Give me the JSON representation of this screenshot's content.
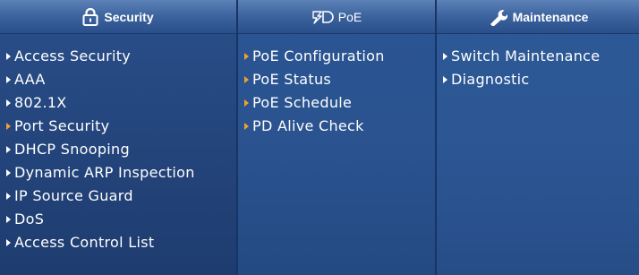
{
  "colors": {
    "arrow_default": "#ffffff",
    "arrow_highlight": "#f0a030",
    "text": "#ffffff"
  },
  "columns": [
    {
      "title": "Security",
      "icon": "padlock-icon",
      "items": [
        {
          "label": "Access Security",
          "arrow": "white"
        },
        {
          "label": "AAA",
          "arrow": "white"
        },
        {
          "label": "802.1X",
          "arrow": "white"
        },
        {
          "label": "Port Security",
          "arrow": "orange"
        },
        {
          "label": "DHCP Snooping",
          "arrow": "white"
        },
        {
          "label": "Dynamic ARP Inspection",
          "arrow": "white"
        },
        {
          "label": "IP Source Guard",
          "arrow": "white"
        },
        {
          "label": "DoS",
          "arrow": "white"
        },
        {
          "label": "Access Control List",
          "arrow": "white"
        }
      ]
    },
    {
      "title": "PoE",
      "icon": "poe-icon",
      "items": [
        {
          "label": "PoE Configuration",
          "arrow": "orange"
        },
        {
          "label": "PoE Status",
          "arrow": "orange"
        },
        {
          "label": "PoE Schedule",
          "arrow": "orange"
        },
        {
          "label": "PD Alive Check",
          "arrow": "orange"
        }
      ]
    },
    {
      "title": "Maintenance",
      "icon": "wrench-icon",
      "items": [
        {
          "label": "Switch Maintenance",
          "arrow": "white"
        },
        {
          "label": "Diagnostic",
          "arrow": "white"
        }
      ]
    }
  ]
}
